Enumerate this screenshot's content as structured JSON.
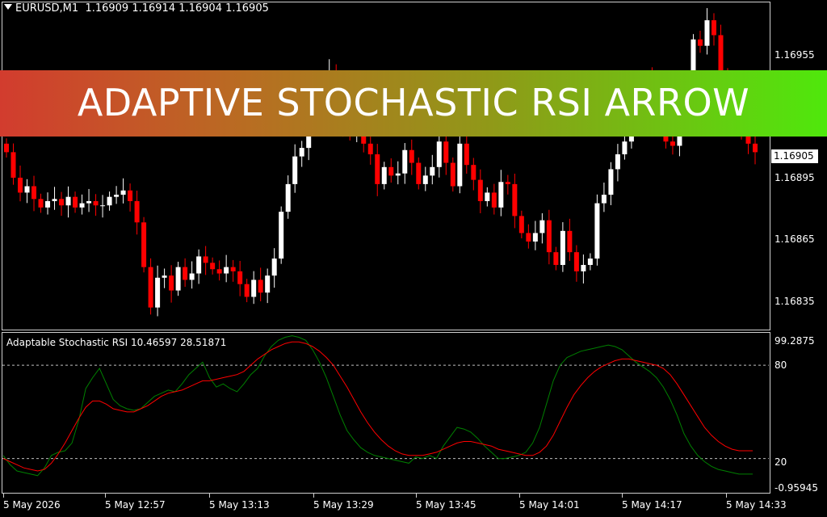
{
  "price_panel": {
    "symbol_label": "EURUSD,M1",
    "ohlc_values": "1.16909 1.16914 1.16904 1.16905",
    "current_price": "1.16905",
    "price_axis": [
      "1.16955",
      "1.16895",
      "1.16865",
      "1.16835"
    ]
  },
  "indicator_panel": {
    "label": "Adaptable Stochastic RSI 10.46597 28.51871",
    "axis_top": "99.2875",
    "level_high": "80",
    "level_low": "20",
    "axis_bottom": "-0.95945"
  },
  "time_axis": [
    "5 May 2026",
    "5 May 12:57",
    "5 May 13:13",
    "5 May 13:29",
    "5 May 13:45",
    "5 May 14:01",
    "5 May 14:17",
    "5 May 14:33"
  ],
  "banner": {
    "title": "ADAPTIVE STOCHASTIC RSI ARROW"
  },
  "colors": {
    "bull_candle": "#ffffff",
    "bear_candle": "#ff0000",
    "signal_line": "#ff0000",
    "main_line": "#008000",
    "background": "#000000"
  },
  "chart_data": [
    {
      "type": "candlestick",
      "ylim": [
        1.16822,
        1.16975
      ],
      "candles_close": [
        1.16905,
        1.16893,
        1.16886,
        1.16889,
        1.16883,
        1.16879,
        1.16882,
        1.16883,
        1.1688,
        1.16884,
        1.16879,
        1.16881,
        1.16882,
        1.1688,
        1.1688,
        1.16884,
        1.16885,
        1.16887,
        1.16882,
        1.16872,
        1.16851,
        1.16832,
        1.16846,
        1.16847,
        1.1684,
        1.16851,
        1.16845,
        1.16848,
        1.16856,
        1.16853,
        1.1685,
        1.16848,
        1.16851,
        1.16849,
        1.16843,
        1.16837,
        1.16845,
        1.16839,
        1.16847,
        1.16855,
        1.16877,
        1.1689,
        1.16903,
        1.16907,
        1.16918,
        1.1693,
        1.16935,
        1.16943,
        1.1693,
        1.16918,
        1.16913,
        1.16928,
        1.16909,
        1.16904,
        1.1689,
        1.16898,
        1.16894,
        1.16895,
        1.16906,
        1.169,
        1.1689,
        1.16894,
        1.16898,
        1.1691,
        1.169,
        1.16889,
        1.16909,
        1.16899,
        1.16892,
        1.16882,
        1.16886,
        1.16879,
        1.16891,
        1.1689,
        1.16875,
        1.16867,
        1.16863,
        1.16867,
        1.16873,
        1.16858,
        1.16852,
        1.16868,
        1.16858,
        1.16849,
        1.16852,
        1.16855,
        1.16881,
        1.16885,
        1.16897,
        1.16904,
        1.1691,
        1.16922,
        1.16934,
        1.1694,
        1.16926,
        1.16918,
        1.1691,
        1.16908,
        1.16922,
        1.16935,
        1.16958,
        1.16955,
        1.16967,
        1.1696,
        1.16942,
        1.16935,
        1.16925,
        1.16915,
        1.16909,
        1.16905
      ],
      "x_ticks": [
        "5 May 2026",
        "5 May 12:57",
        "5 May 13:13",
        "5 May 13:29",
        "5 May 13:45",
        "5 May 14:01",
        "5 May 14:17",
        "5 May 14:33"
      ]
    },
    {
      "type": "line",
      "ylim": [
        -0.95945,
        99.2875
      ],
      "levels": [
        80,
        20
      ],
      "series": [
        {
          "values": [
            22,
            16,
            12,
            11,
            10,
            9,
            14,
            22,
            24,
            25,
            30,
            45,
            65,
            72,
            78,
            68,
            58,
            54,
            52,
            51,
            52,
            56,
            60,
            62,
            64,
            63,
            68,
            74,
            78,
            82,
            72,
            66,
            68,
            65,
            63,
            68,
            74,
            78,
            86,
            92,
            96,
            98,
            99,
            98,
            96,
            90,
            82,
            72,
            60,
            48,
            38,
            32,
            27,
            24,
            22,
            21,
            20,
            19,
            18,
            17,
            21,
            20,
            22,
            20,
            28,
            34,
            40,
            39,
            37,
            33,
            28,
            24,
            20,
            20,
            21,
            22,
            24,
            30,
            40,
            55,
            70,
            80,
            85,
            87,
            89,
            90,
            91,
            92,
            93,
            92,
            90,
            86,
            82,
            79,
            76,
            72,
            66,
            58,
            48,
            36,
            28,
            22,
            18,
            15,
            13,
            12,
            11,
            10,
            10,
            10
          ]
        },
        {
          "values": [
            20,
            18,
            16,
            14,
            13,
            12,
            13,
            17,
            23,
            30,
            38,
            46,
            53,
            57,
            57,
            55,
            52,
            51,
            50,
            50,
            52,
            54,
            57,
            60,
            62,
            63,
            64,
            66,
            68,
            70,
            70,
            71,
            72,
            73,
            74,
            76,
            80,
            84,
            87,
            90,
            92,
            94,
            95,
            95,
            94,
            92,
            89,
            85,
            80,
            73,
            66,
            58,
            50,
            43,
            37,
            32,
            28,
            25,
            23,
            22,
            22,
            22,
            23,
            24,
            26,
            28,
            30,
            31,
            31,
            30,
            29,
            28,
            26,
            25,
            24,
            23,
            22,
            22,
            24,
            28,
            35,
            44,
            53,
            61,
            67,
            72,
            76,
            79,
            81,
            83,
            84,
            84,
            83,
            82,
            81,
            80,
            78,
            74,
            68,
            61,
            54,
            47,
            40,
            35,
            31,
            28,
            26,
            25,
            25,
            25
          ]
        }
      ]
    }
  ]
}
